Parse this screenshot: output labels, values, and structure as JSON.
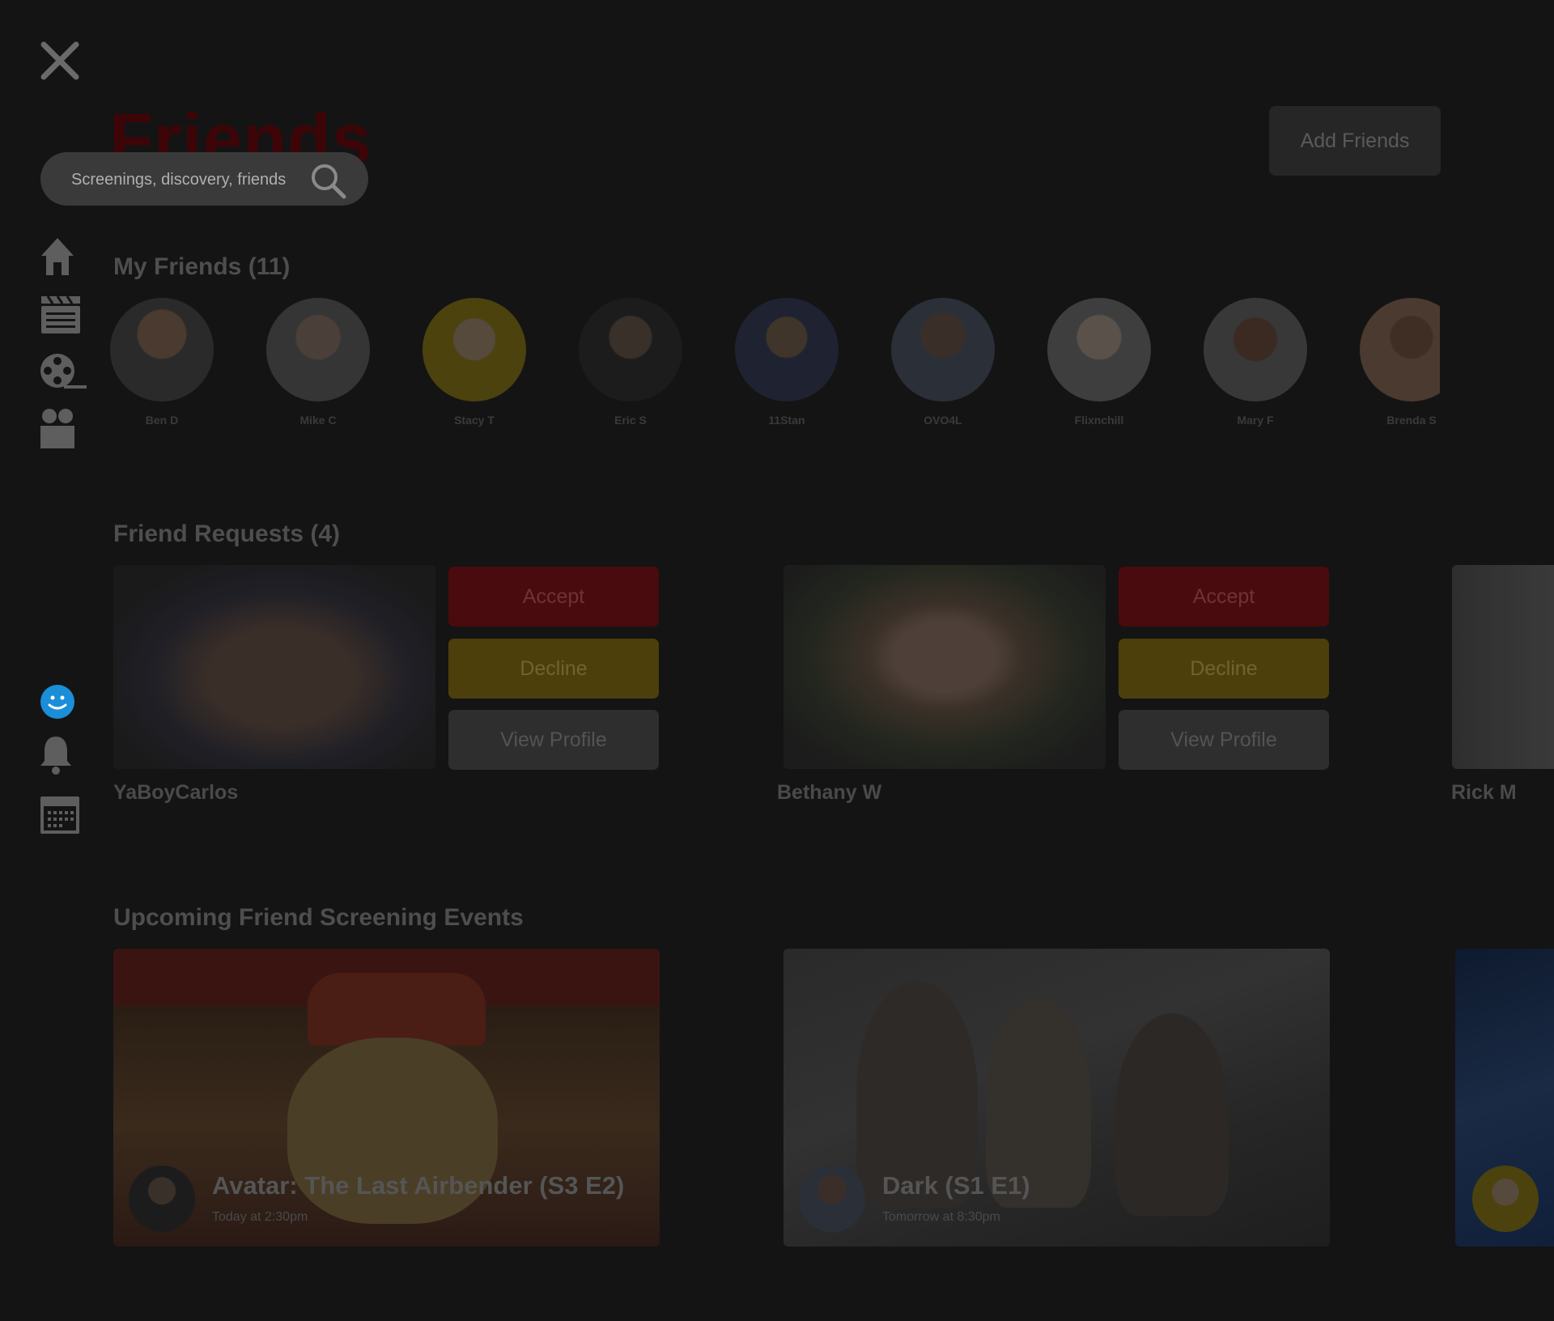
{
  "page": {
    "title": "Friends",
    "add_friends_label": "Add Friends"
  },
  "search": {
    "placeholder": "Screenings, discovery, friends"
  },
  "sidebar": {
    "items": [
      {
        "icon": "home-icon"
      },
      {
        "icon": "clapperboard-icon"
      },
      {
        "icon": "film-reel-icon"
      },
      {
        "icon": "friends-icon"
      },
      {
        "icon": "profile-smiley-icon"
      },
      {
        "icon": "bell-icon"
      },
      {
        "icon": "calendar-icon"
      }
    ]
  },
  "my_friends": {
    "title": "My Friends (11)",
    "friends": [
      {
        "name": "Ben D"
      },
      {
        "name": "Mike C"
      },
      {
        "name": "Stacy T"
      },
      {
        "name": "Eric S"
      },
      {
        "name": "11Stan"
      },
      {
        "name": "OVO4L"
      },
      {
        "name": "Flixnchill"
      },
      {
        "name": "Mary F"
      },
      {
        "name": "Brenda S"
      }
    ]
  },
  "friend_requests": {
    "title": "Friend Requests (4)",
    "accept_label": "Accept",
    "decline_label": "Decline",
    "view_profile_label": "View Profile",
    "requests": [
      {
        "name": "YaBoyCarlos"
      },
      {
        "name": "Bethany W"
      },
      {
        "name": "Rick M"
      }
    ]
  },
  "events": {
    "title": "Upcoming Friend Screening Events",
    "items": [
      {
        "title": "Avatar: The Last Airbender (S3 E2)",
        "time": "Today at 2:30pm"
      },
      {
        "title": "Dark (S1 E1)",
        "time": "Tomorrow at 8:30pm"
      },
      {
        "title": "",
        "time": ""
      }
    ]
  },
  "colors": {
    "background": "#141414",
    "accent_red": "#4a0b0e",
    "accent_gold": "#4c3f0b",
    "smiley_blue": "#1a8ed8"
  }
}
